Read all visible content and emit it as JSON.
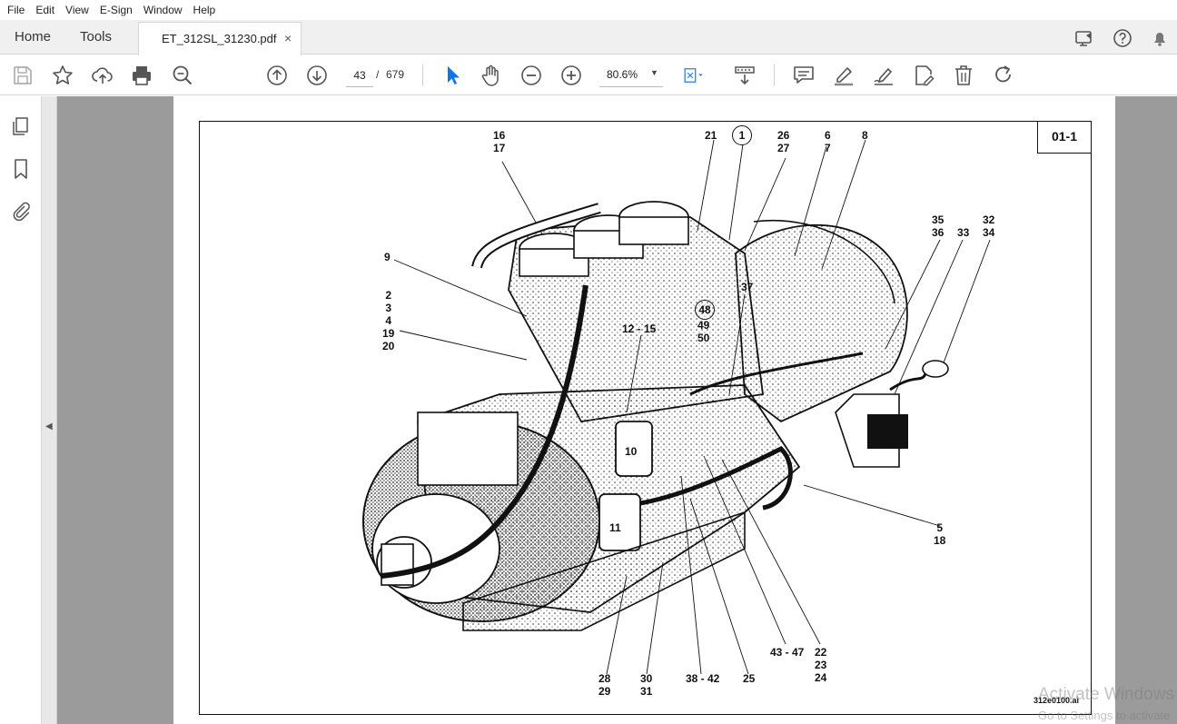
{
  "menu": [
    "File",
    "Edit",
    "View",
    "E-Sign",
    "Window",
    "Help"
  ],
  "tabs": {
    "home": "Home",
    "tools": "Tools",
    "document": "ET_312SL_31230.pdf",
    "close_glyph": "×"
  },
  "toolbar": {
    "current_page": "43",
    "page_separator": "/",
    "total_pages": "679",
    "zoom": "80.6%"
  },
  "document": {
    "page_id": "01-1",
    "figure_file": "312e0100.ai",
    "callouts": {
      "c_16_17": "16\n17",
      "c_21": "21",
      "c_1": "1",
      "c_26_27": "26\n27",
      "c_6_7": "6\n7",
      "c_8": "8",
      "c_9": "9",
      "c_35_36": "35\n36",
      "c_32_34": "32\n34",
      "c_33": "33",
      "c_2_20": "2\n3\n4\n19\n20",
      "c_37": "37",
      "c_48": "48",
      "c_49_50": "49\n50",
      "c_12_15": "12 - 15",
      "c_10": "10",
      "c_11": "11",
      "c_5_18": "5\n18",
      "c_43_47": "43 - 47",
      "c_22_24": "22\n23\n24",
      "c_28_29": "28\n29",
      "c_30_31": "30\n31",
      "c_38_42": "38 - 42",
      "c_25": "25"
    }
  },
  "watermark": {
    "line1": "Activate Windows",
    "line2": "Go to Settings to activate"
  },
  "colors": {
    "accent_blue": "#1473e6",
    "viewer_bg": "#9b9b9b"
  }
}
